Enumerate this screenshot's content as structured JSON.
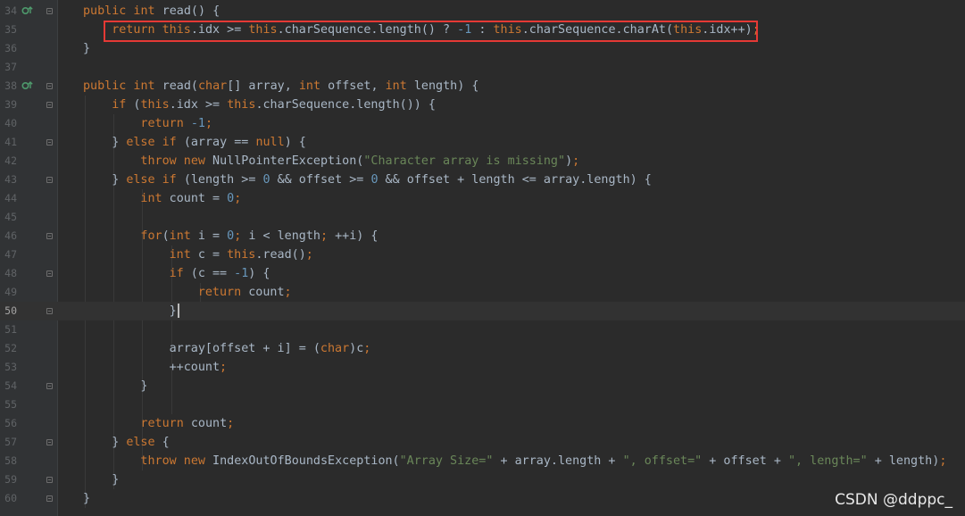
{
  "editor": {
    "lines": [
      {
        "num": "34",
        "current": false,
        "impl": true,
        "fold": true,
        "indent": 1,
        "tokens": [
          {
            "t": "public int ",
            "c": "k"
          },
          {
            "t": "read() {",
            "c": ""
          }
        ]
      },
      {
        "num": "35",
        "current": false,
        "impl": false,
        "fold": false,
        "indent": 2,
        "tokens": [
          {
            "t": "return this",
            "c": "k"
          },
          {
            "t": ".idx >= ",
            "c": ""
          },
          {
            "t": "this",
            "c": "k"
          },
          {
            "t": ".charSequence.length() ? ",
            "c": ""
          },
          {
            "t": "-1",
            "c": "n"
          },
          {
            "t": " : ",
            "c": ""
          },
          {
            "t": "this",
            "c": "k"
          },
          {
            "t": ".charSequence.charAt(",
            "c": ""
          },
          {
            "t": "this",
            "c": "k"
          },
          {
            "t": ".idx++)",
            "c": ""
          },
          {
            "t": ";",
            "c": "p"
          }
        ]
      },
      {
        "num": "36",
        "current": false,
        "impl": false,
        "fold": false,
        "indent": 1,
        "tokens": [
          {
            "t": "}",
            "c": ""
          }
        ]
      },
      {
        "num": "37",
        "current": false,
        "impl": false,
        "fold": false,
        "indent": 0,
        "tokens": []
      },
      {
        "num": "38",
        "current": false,
        "impl": true,
        "fold": true,
        "indent": 1,
        "tokens": [
          {
            "t": "public int ",
            "c": "k"
          },
          {
            "t": "read(",
            "c": ""
          },
          {
            "t": "char",
            "c": "k"
          },
          {
            "t": "[] array, ",
            "c": ""
          },
          {
            "t": "int ",
            "c": "k"
          },
          {
            "t": "offset, ",
            "c": ""
          },
          {
            "t": "int ",
            "c": "k"
          },
          {
            "t": "length) {",
            "c": ""
          }
        ]
      },
      {
        "num": "39",
        "current": false,
        "impl": false,
        "fold": true,
        "indent": 2,
        "tokens": [
          {
            "t": "if ",
            "c": "k"
          },
          {
            "t": "(",
            "c": ""
          },
          {
            "t": "this",
            "c": "k"
          },
          {
            "t": ".idx >= ",
            "c": ""
          },
          {
            "t": "this",
            "c": "k"
          },
          {
            "t": ".charSequence.length()) {",
            "c": ""
          }
        ]
      },
      {
        "num": "40",
        "current": false,
        "impl": false,
        "fold": false,
        "indent": 3,
        "tokens": [
          {
            "t": "return ",
            "c": "k"
          },
          {
            "t": "-1",
            "c": "n"
          },
          {
            "t": ";",
            "c": "p"
          }
        ]
      },
      {
        "num": "41",
        "current": false,
        "impl": false,
        "fold": true,
        "indent": 2,
        "tokens": [
          {
            "t": "} ",
            "c": ""
          },
          {
            "t": "else if ",
            "c": "k"
          },
          {
            "t": "(array == ",
            "c": ""
          },
          {
            "t": "null",
            "c": "k"
          },
          {
            "t": ") {",
            "c": ""
          }
        ]
      },
      {
        "num": "42",
        "current": false,
        "impl": false,
        "fold": false,
        "indent": 3,
        "tokens": [
          {
            "t": "throw new ",
            "c": "k"
          },
          {
            "t": "NullPointerException(",
            "c": ""
          },
          {
            "t": "\"Character array is missing\"",
            "c": "s"
          },
          {
            "t": ")",
            "c": ""
          },
          {
            "t": ";",
            "c": "p"
          }
        ]
      },
      {
        "num": "43",
        "current": false,
        "impl": false,
        "fold": true,
        "indent": 2,
        "tokens": [
          {
            "t": "} ",
            "c": ""
          },
          {
            "t": "else if ",
            "c": "k"
          },
          {
            "t": "(length >= ",
            "c": ""
          },
          {
            "t": "0",
            "c": "n"
          },
          {
            "t": " && offset >= ",
            "c": ""
          },
          {
            "t": "0",
            "c": "n"
          },
          {
            "t": " && offset + length <= array.length) {",
            "c": ""
          }
        ]
      },
      {
        "num": "44",
        "current": false,
        "impl": false,
        "fold": false,
        "indent": 3,
        "tokens": [
          {
            "t": "int ",
            "c": "k"
          },
          {
            "t": "count = ",
            "c": ""
          },
          {
            "t": "0",
            "c": "n"
          },
          {
            "t": ";",
            "c": "p"
          }
        ]
      },
      {
        "num": "45",
        "current": false,
        "impl": false,
        "fold": false,
        "indent": 0,
        "tokens": []
      },
      {
        "num": "46",
        "current": false,
        "impl": false,
        "fold": true,
        "indent": 3,
        "tokens": [
          {
            "t": "for",
            "c": "k"
          },
          {
            "t": "(",
            "c": ""
          },
          {
            "t": "int ",
            "c": "k"
          },
          {
            "t": "i = ",
            "c": ""
          },
          {
            "t": "0",
            "c": "n"
          },
          {
            "t": "; ",
            "c": "p"
          },
          {
            "t": "i < length",
            "c": ""
          },
          {
            "t": "; ",
            "c": "p"
          },
          {
            "t": "++i) {",
            "c": ""
          }
        ]
      },
      {
        "num": "47",
        "current": false,
        "impl": false,
        "fold": false,
        "indent": 4,
        "tokens": [
          {
            "t": "int ",
            "c": "k"
          },
          {
            "t": "c = ",
            "c": ""
          },
          {
            "t": "this",
            "c": "k"
          },
          {
            "t": ".read()",
            "c": ""
          },
          {
            "t": ";",
            "c": "p"
          }
        ]
      },
      {
        "num": "48",
        "current": false,
        "impl": false,
        "fold": true,
        "indent": 4,
        "tokens": [
          {
            "t": "if ",
            "c": "k"
          },
          {
            "t": "(c == ",
            "c": ""
          },
          {
            "t": "-1",
            "c": "n"
          },
          {
            "t": ") {",
            "c": ""
          }
        ]
      },
      {
        "num": "49",
        "current": false,
        "impl": false,
        "fold": false,
        "indent": 5,
        "tokens": [
          {
            "t": "return ",
            "c": "k"
          },
          {
            "t": "count",
            "c": ""
          },
          {
            "t": ";",
            "c": "p"
          }
        ]
      },
      {
        "num": "50",
        "current": true,
        "impl": false,
        "fold": true,
        "indent": 4,
        "cursor": true,
        "tokens": [
          {
            "t": "}",
            "c": ""
          }
        ]
      },
      {
        "num": "51",
        "current": false,
        "impl": false,
        "fold": false,
        "indent": 0,
        "tokens": []
      },
      {
        "num": "52",
        "current": false,
        "impl": false,
        "fold": false,
        "indent": 4,
        "tokens": [
          {
            "t": "array[offset + i] = (",
            "c": ""
          },
          {
            "t": "char",
            "c": "k"
          },
          {
            "t": ")c",
            "c": ""
          },
          {
            "t": ";",
            "c": "p"
          }
        ]
      },
      {
        "num": "53",
        "current": false,
        "impl": false,
        "fold": false,
        "indent": 4,
        "tokens": [
          {
            "t": "++count",
            "c": ""
          },
          {
            "t": ";",
            "c": "p"
          }
        ]
      },
      {
        "num": "54",
        "current": false,
        "impl": false,
        "fold": true,
        "indent": 3,
        "tokens": [
          {
            "t": "}",
            "c": ""
          }
        ]
      },
      {
        "num": "55",
        "current": false,
        "impl": false,
        "fold": false,
        "indent": 0,
        "tokens": []
      },
      {
        "num": "56",
        "current": false,
        "impl": false,
        "fold": false,
        "indent": 3,
        "tokens": [
          {
            "t": "return ",
            "c": "k"
          },
          {
            "t": "count",
            "c": ""
          },
          {
            "t": ";",
            "c": "p"
          }
        ]
      },
      {
        "num": "57",
        "current": false,
        "impl": false,
        "fold": true,
        "indent": 2,
        "tokens": [
          {
            "t": "} ",
            "c": ""
          },
          {
            "t": "else ",
            "c": "k"
          },
          {
            "t": "{",
            "c": ""
          }
        ]
      },
      {
        "num": "58",
        "current": false,
        "impl": false,
        "fold": false,
        "indent": 3,
        "tokens": [
          {
            "t": "throw new ",
            "c": "k"
          },
          {
            "t": "IndexOutOfBoundsException(",
            "c": ""
          },
          {
            "t": "\"Array Size=\"",
            "c": "s"
          },
          {
            "t": " + array.length + ",
            "c": ""
          },
          {
            "t": "\", offset=\"",
            "c": "s"
          },
          {
            "t": " + offset + ",
            "c": ""
          },
          {
            "t": "\", length=\"",
            "c": "s"
          },
          {
            "t": " + length)",
            "c": ""
          },
          {
            "t": ";",
            "c": "p"
          }
        ]
      },
      {
        "num": "59",
        "current": false,
        "impl": false,
        "fold": true,
        "indent": 2,
        "tokens": [
          {
            "t": "}",
            "c": ""
          }
        ]
      },
      {
        "num": "60",
        "current": false,
        "impl": false,
        "fold": true,
        "indent": 1,
        "tokens": [
          {
            "t": "}",
            "c": ""
          }
        ]
      }
    ]
  },
  "icons": {
    "implements": "implements-method-icon",
    "fold": "fold-marker-icon"
  },
  "colors": {
    "background": "#2b2b2b",
    "keyword": "#cc7832",
    "number": "#6897bb",
    "string": "#6a8759",
    "text": "#a9b7c6",
    "highlight_box": "#e53935"
  },
  "watermark": {
    "text": "CSDN @ddppc_"
  }
}
